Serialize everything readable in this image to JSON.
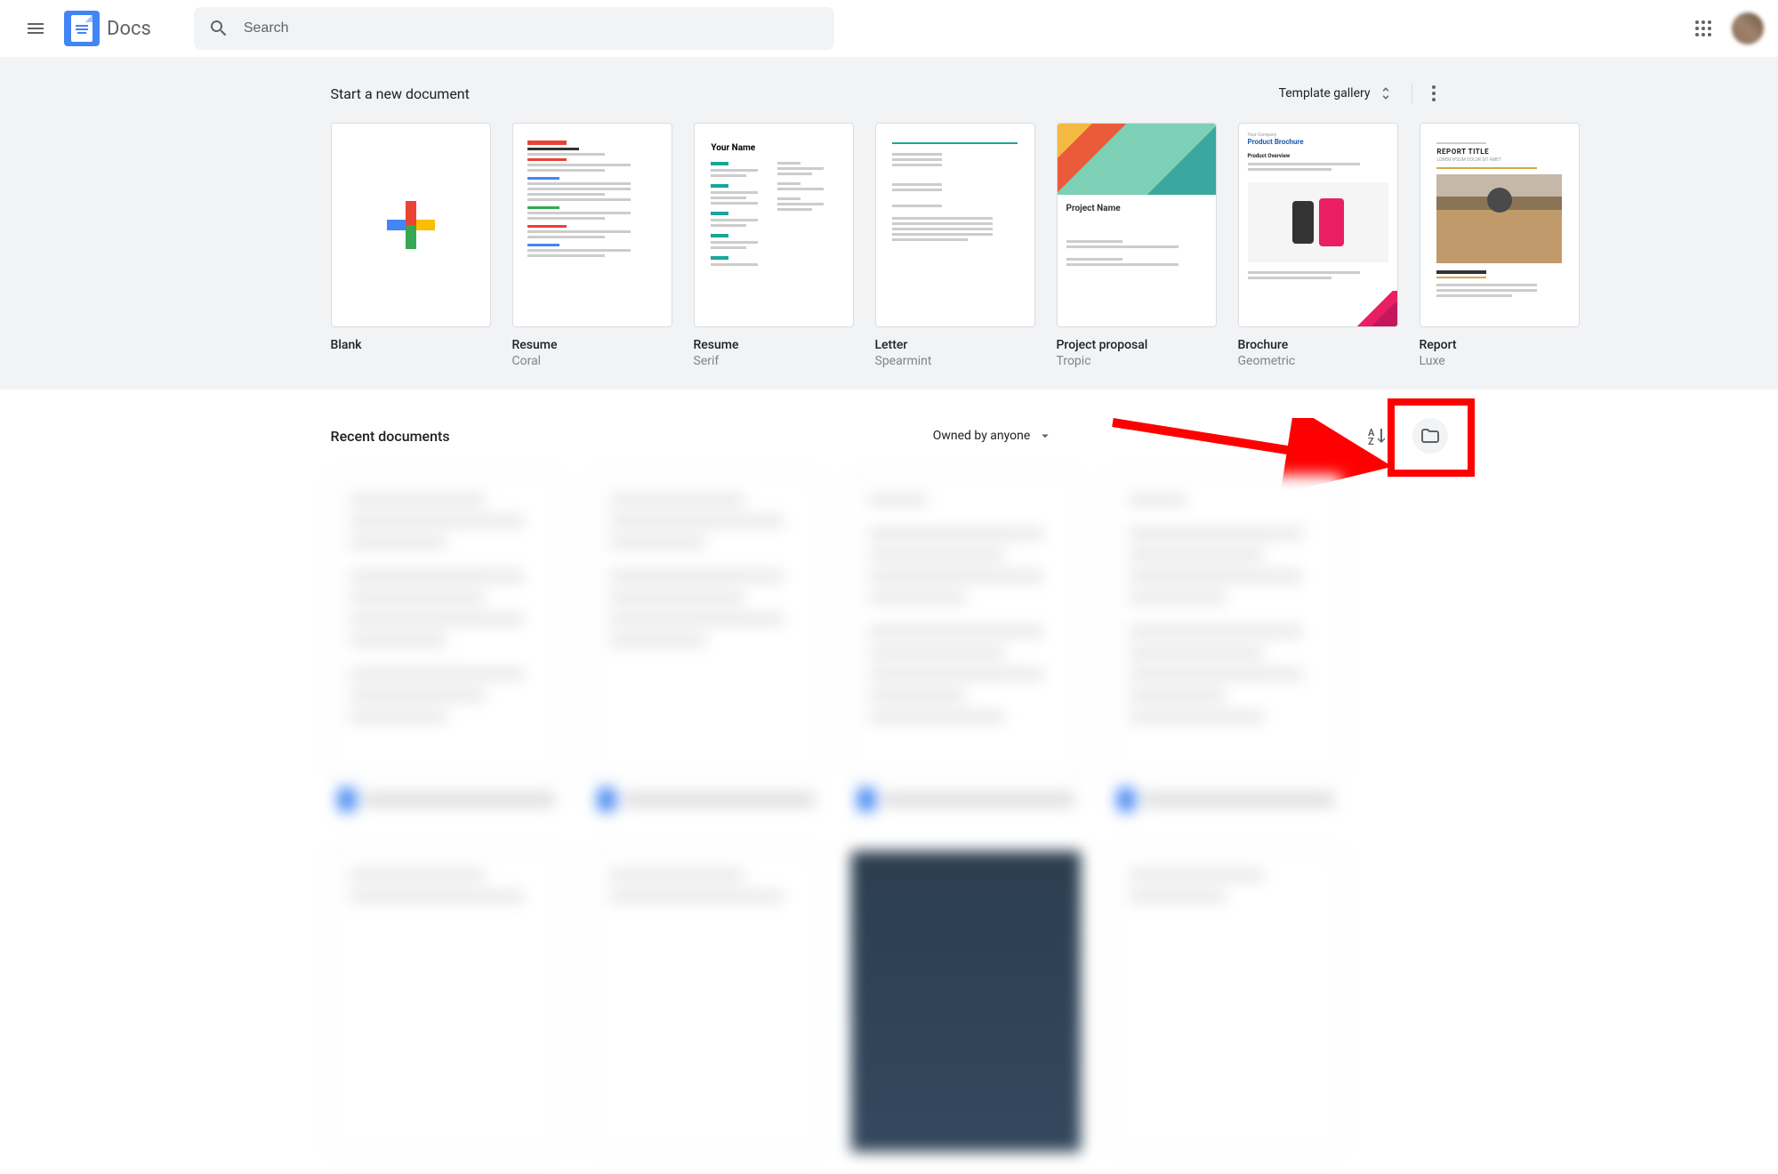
{
  "header": {
    "app_title": "Docs",
    "search_placeholder": "Search"
  },
  "templates": {
    "section_title": "Start a new document",
    "gallery_button": "Template gallery",
    "items": [
      {
        "name": "Blank",
        "sub": ""
      },
      {
        "name": "Resume",
        "sub": "Coral"
      },
      {
        "name": "Resume",
        "sub": "Serif"
      },
      {
        "name": "Letter",
        "sub": "Spearmint"
      },
      {
        "name": "Project proposal",
        "sub": "Tropic"
      },
      {
        "name": "Brochure",
        "sub": "Geometric"
      },
      {
        "name": "Report",
        "sub": "Luxe"
      }
    ],
    "thumb_text": {
      "resume_serif_name": "Your Name",
      "proposal_title": "Project Name",
      "brochure_company": "Your Company",
      "brochure_title": "Product Brochure",
      "brochure_section": "Product Overview",
      "report_title": "REPORT TITLE",
      "report_sub": "LOREM IPSUM DOLOR SIT AMET"
    }
  },
  "recent": {
    "section_title": "Recent documents",
    "owner_filter": "Owned by anyone"
  }
}
